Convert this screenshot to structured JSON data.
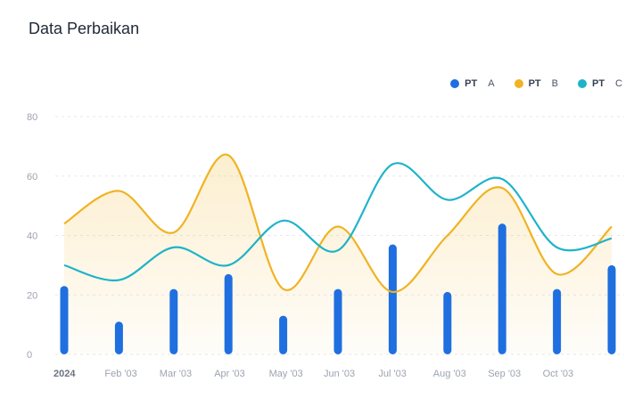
{
  "title": "Data Perbaikan",
  "legend": [
    {
      "prefix": "PT",
      "suffix": "A",
      "color": "#1f6fe0"
    },
    {
      "prefix": "PT",
      "suffix": "B",
      "color": "#f0b323"
    },
    {
      "prefix": "PT",
      "suffix": "C",
      "color": "#1fb3c9"
    }
  ],
  "chart_data": {
    "type": "bar",
    "x_labels": [
      "2024",
      "Feb '03",
      "Mar '03",
      "Apr '03",
      "May '03",
      "Jun '03",
      "Jul '03",
      "Aug '03",
      "Sep '03",
      "Oct '03",
      ""
    ],
    "ylim": [
      0,
      80
    ],
    "yticks": [
      0,
      20,
      40,
      60,
      80
    ],
    "grid": true,
    "legend_position": "top-right",
    "series": [
      {
        "name": "PT A",
        "type": "bar",
        "color": "#1f6fe0",
        "values": [
          23,
          11,
          22,
          27,
          13,
          22,
          37,
          21,
          44,
          22,
          30
        ]
      },
      {
        "name": "PT B",
        "type": "area",
        "color": "#f0b323",
        "values": [
          44,
          55,
          41,
          67,
          22,
          43,
          21,
          40,
          56,
          27,
          43
        ]
      },
      {
        "name": "PT C",
        "type": "line",
        "color": "#1fb3c9",
        "values": [
          30,
          25,
          36,
          30,
          45,
          35,
          64,
          52,
          59,
          36,
          39
        ]
      }
    ]
  }
}
